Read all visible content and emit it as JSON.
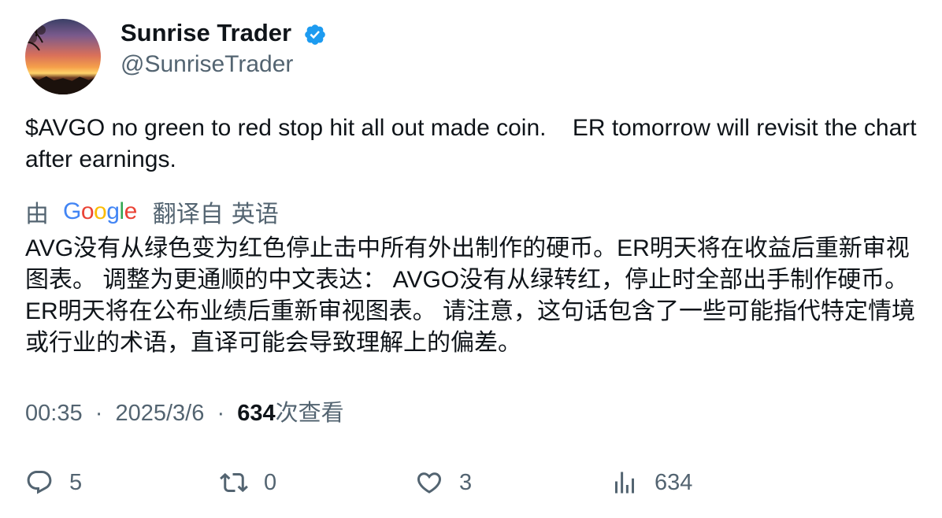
{
  "author": {
    "name": "Sunrise Trader",
    "handle": "@SunriseTrader",
    "verified": true,
    "verified_color": "#1d9bf0"
  },
  "tweet": {
    "text": "$AVGO no green to red stop hit all out made coin.    ER tomorrow will revisit the chart after earnings."
  },
  "translation": {
    "by_label": "由",
    "provider": "Google",
    "from_label": "翻译自",
    "language": "英语",
    "text": "AVG没有从绿色变为红色停止击中所有外出制作的硬币。ER明天将在收益后重新审视图表。 调整为更通顺的中文表达： AVGO没有从绿转红，停止时全部出手制作硬币。ER明天将在公布业绩后重新审视图表。 请注意，这句话包含了一些可能指代特定情境或行业的术语，直译可能会导致理解上的偏差。"
  },
  "meta": {
    "time": "00:35",
    "separator": "·",
    "date": "2025/3/6",
    "views_count": "634",
    "views_label": "次查看"
  },
  "actions": {
    "replies": "5",
    "retweets": "0",
    "likes": "3",
    "views": "634"
  },
  "icons": {
    "reply": "reply-icon",
    "retweet": "retweet-icon",
    "like": "heart-icon",
    "views": "views-chart-icon",
    "verified": "verified-badge-icon"
  },
  "colors": {
    "text_primary": "#0f1419",
    "text_secondary": "#536471",
    "google_blue": "#4285f4",
    "google_red": "#ea4335",
    "google_yellow": "#fbbc05",
    "google_green": "#34a853"
  }
}
